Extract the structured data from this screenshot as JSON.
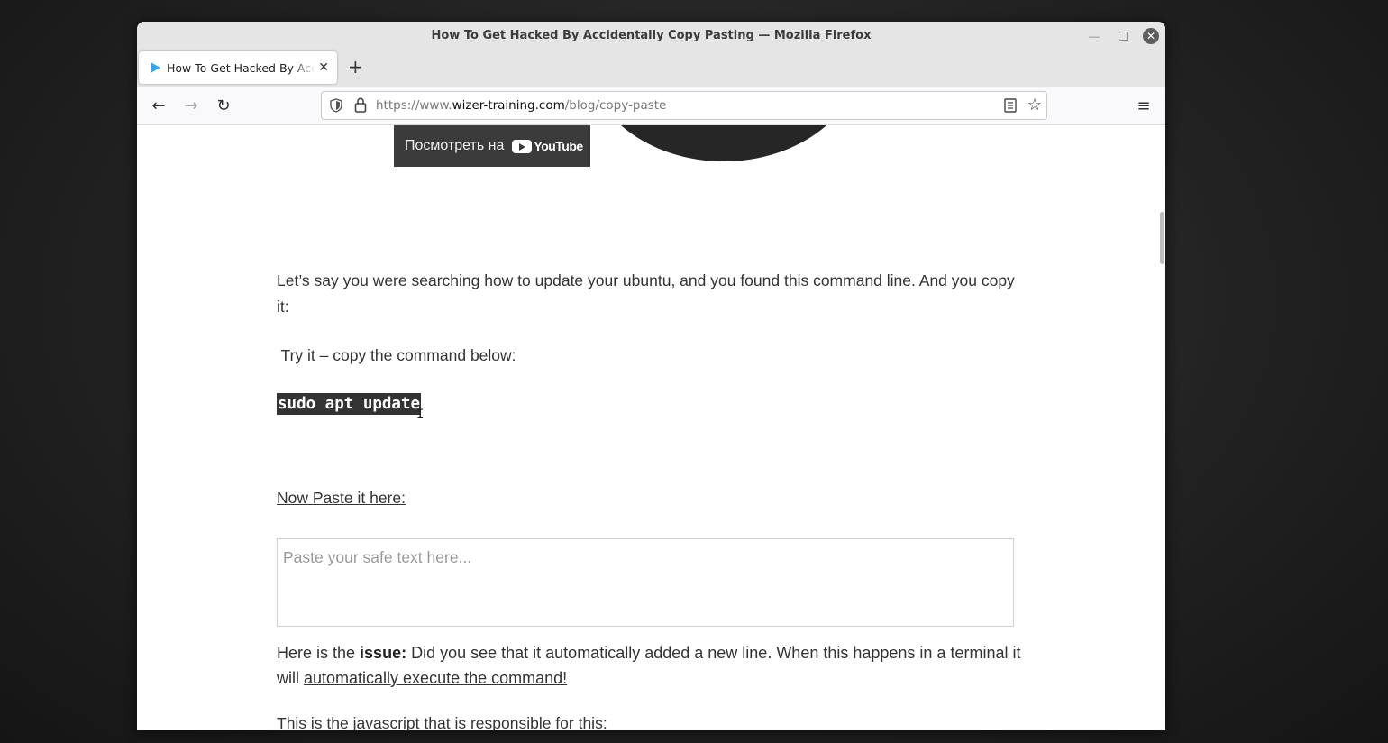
{
  "window": {
    "title": "How To Get Hacked By Accidentally Copy Pasting — Mozilla Firefox",
    "min_icon": "minimize-icon",
    "max_icon": "maximize-icon",
    "close_icon": "close-icon",
    "close_glyph": "✕"
  },
  "tabs": {
    "active_label": "How To Get Hacked By Accidentally Copy Pasting",
    "close_glyph": "✕",
    "new_tab_glyph": "+",
    "accent": "#3aa2e8"
  },
  "navbar": {
    "back_glyph": "←",
    "forward_glyph": "→",
    "reload_glyph": "↻",
    "menu_glyph": "≡",
    "url_prefix": "https://www.",
    "url_domain": "wizer-training.com",
    "url_path": "/blog/copy-paste",
    "star_glyph": "☆"
  },
  "content": {
    "youtube_label": "Посмотреть на",
    "youtube_word": "YouTube",
    "para1": "Let’s say you were searching how to update your ubuntu, and you found this command line. And you copy it:",
    "para2": " Try it – copy the command below:",
    "command": "sudo apt update",
    "paste_link": "Now Paste it here:",
    "paste_placeholder": "Paste your safe text here...",
    "issue_prefix": "Here is the ",
    "issue_bold": "issue:",
    "issue_text": " Did you see that it automatically added a new line. When this happens in a terminal it will ",
    "issue_link": "automatically execute the command! ",
    "para4": "This is the javascript that is responsible for this:"
  }
}
